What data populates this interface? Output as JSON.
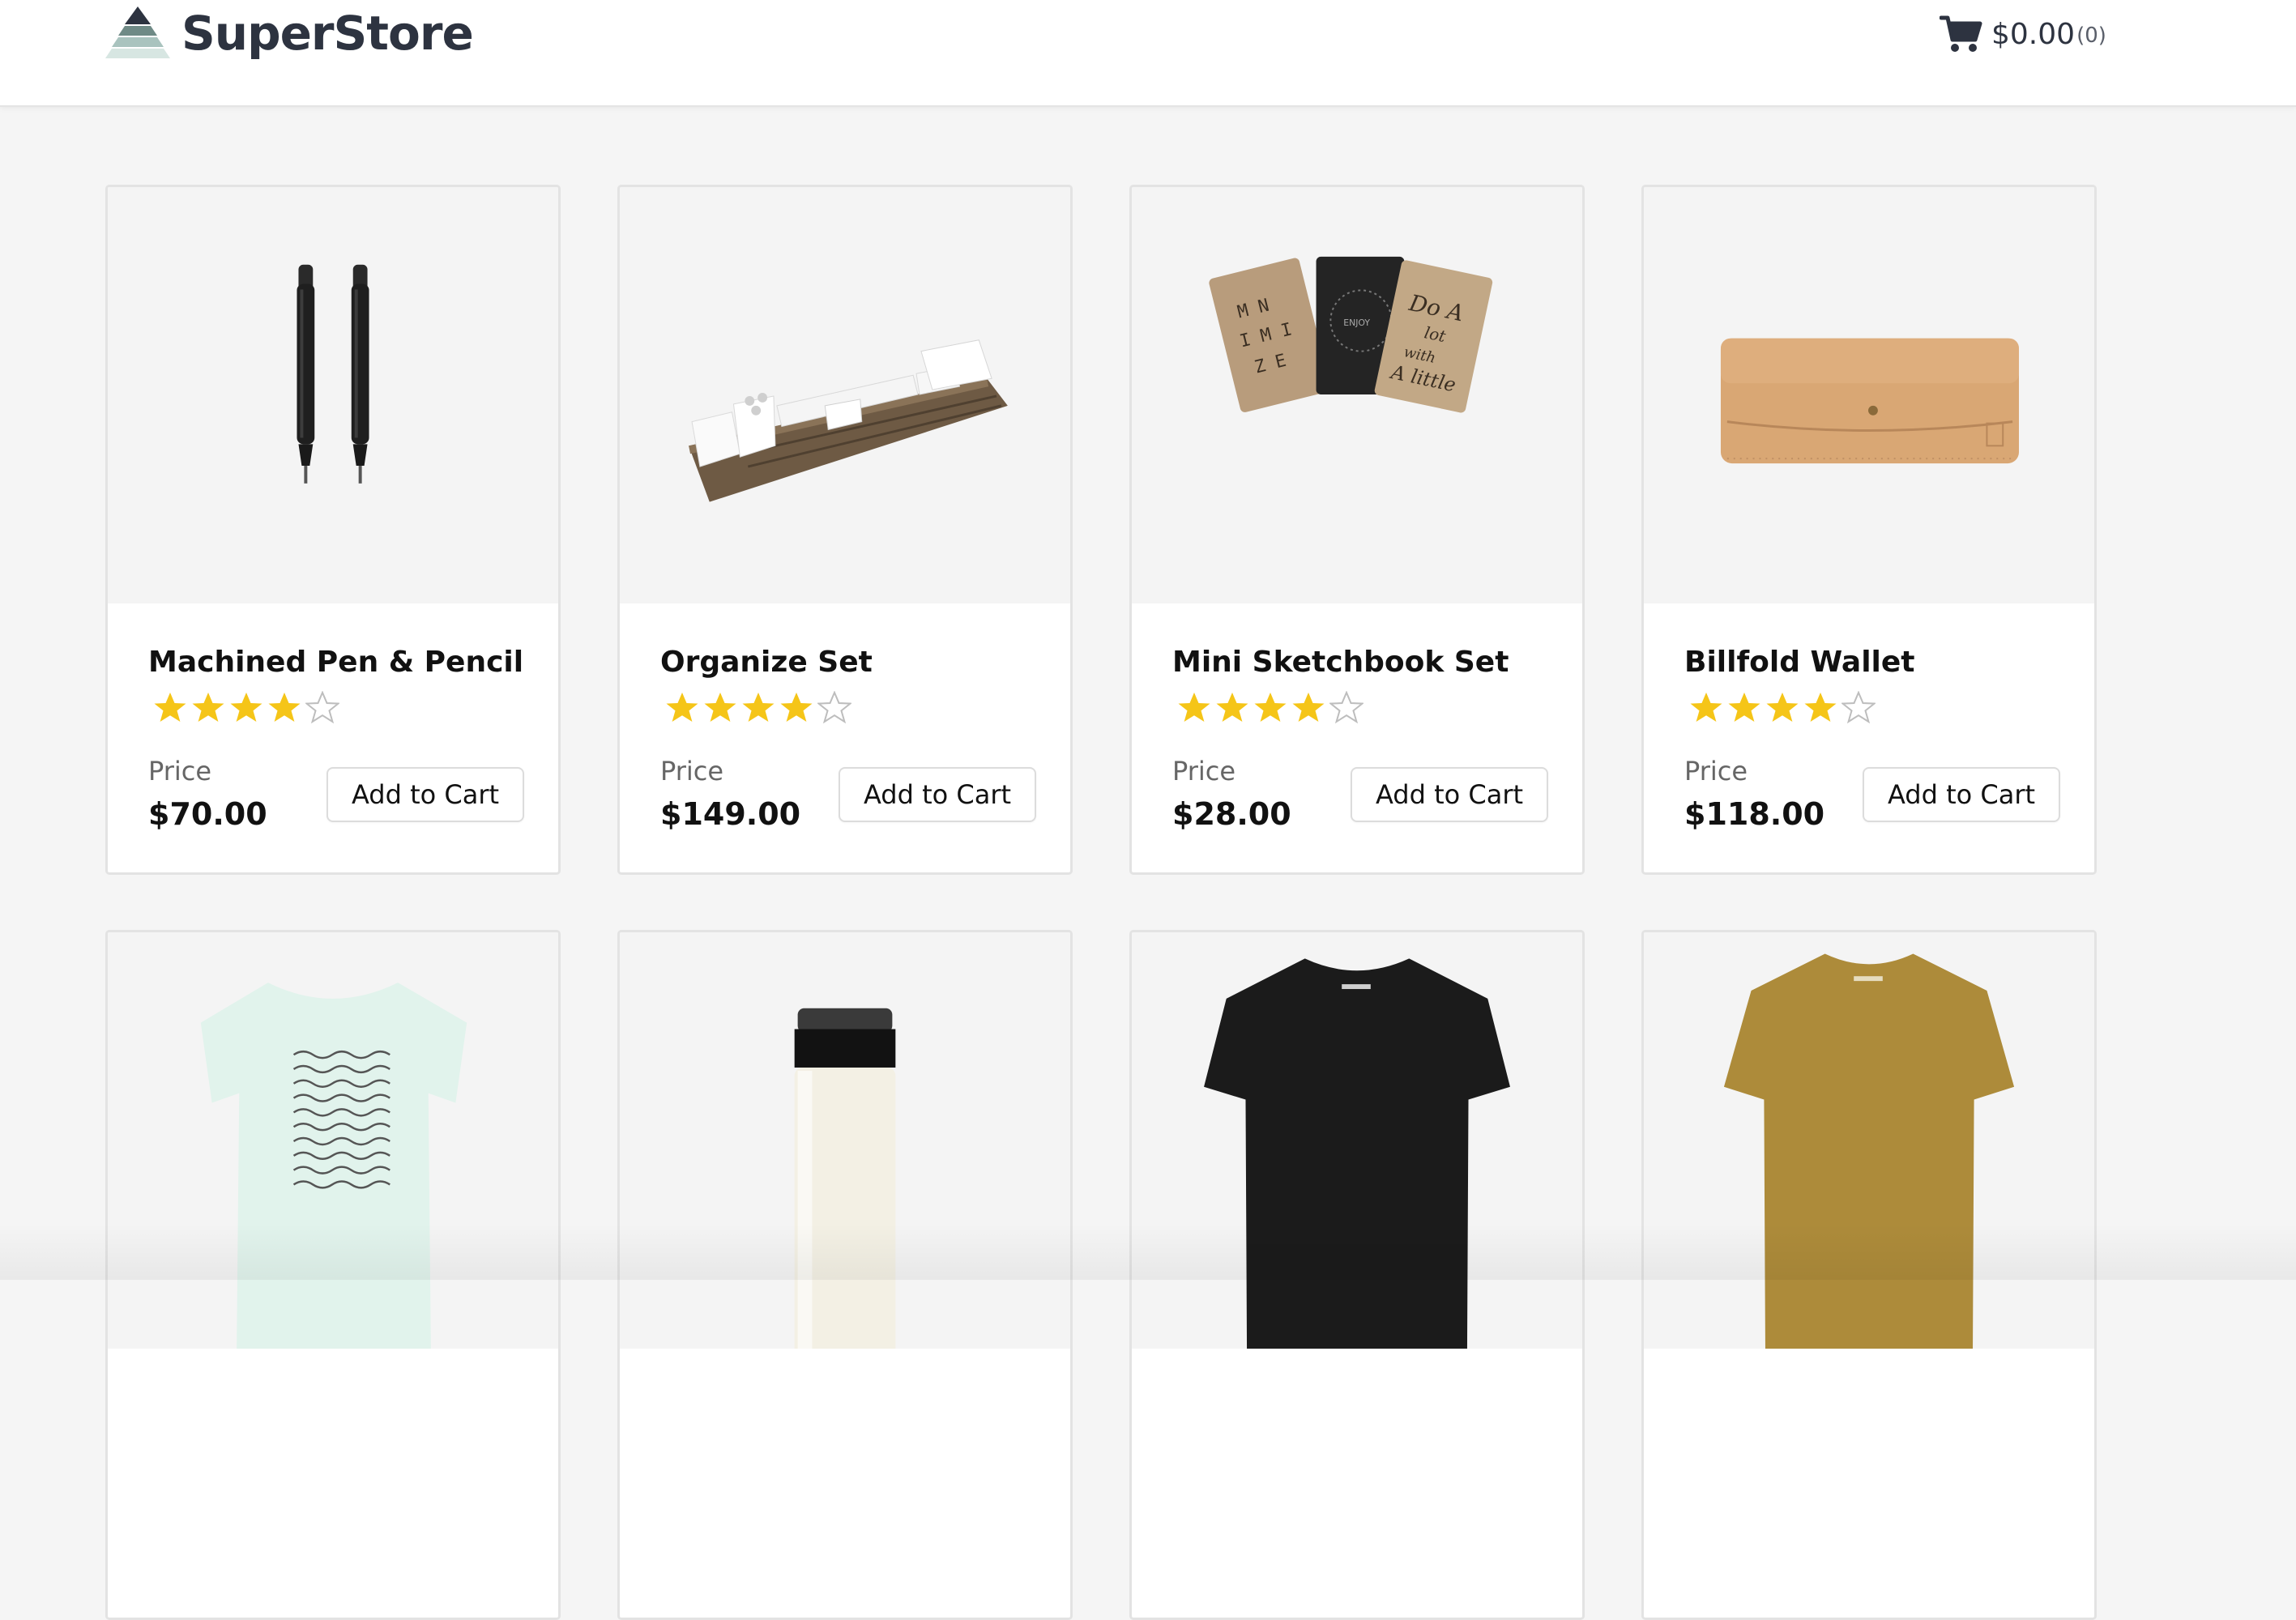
{
  "header": {
    "brand": "SuperStore",
    "logo_icon": "triangle-stack-logo",
    "cart_icon": "shopping-cart-icon",
    "cart_total": "$0.00",
    "cart_count": "(0)"
  },
  "colors": {
    "header_bg": "#ffffff",
    "page_bg": "#f5f5f5",
    "brand_text": "#2d3340",
    "star_filled": "#f5c518",
    "star_empty": "#bdbdbd"
  },
  "products": [
    {
      "name": "Machined Pen & Pencil",
      "rating": 4,
      "max_rating": 5,
      "price_label": "Price",
      "price": "$70.00",
      "button": "Add to Cart",
      "image_icon": "pen-pencil-image"
    },
    {
      "name": "Organize Set",
      "rating": 4,
      "max_rating": 5,
      "price_label": "Price",
      "price": "$149.00",
      "button": "Add to Cart",
      "image_icon": "organizer-tray-image"
    },
    {
      "name": "Mini Sketchbook Set",
      "rating": 4,
      "max_rating": 5,
      "price_label": "Price",
      "price": "$28.00",
      "button": "Add to Cart",
      "image_icon": "sketchbooks-image"
    },
    {
      "name": "Billfold Wallet",
      "rating": 4,
      "max_rating": 5,
      "price_label": "Price",
      "price": "$118.00",
      "button": "Add to Cart",
      "image_icon": "leather-wallet-image"
    },
    {
      "name": "",
      "image_icon": "wave-print-tshirt-image"
    },
    {
      "name": "",
      "image_icon": "travel-tumbler-image"
    },
    {
      "name": "",
      "image_icon": "black-tshirt-image"
    },
    {
      "name": "",
      "image_icon": "olive-tshirt-image"
    }
  ]
}
